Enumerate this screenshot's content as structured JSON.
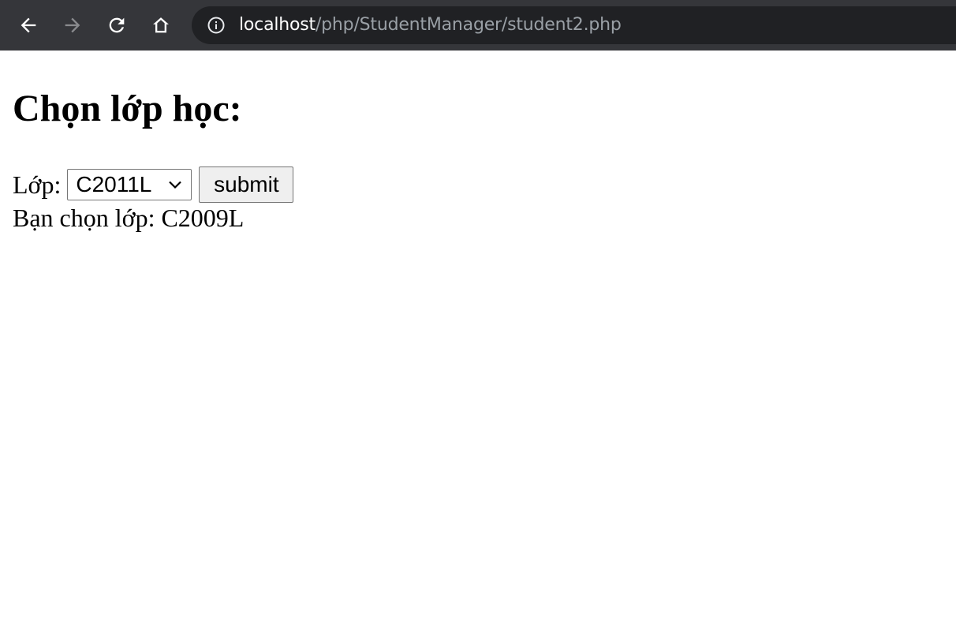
{
  "browser": {
    "url_host": "localhost",
    "url_path": "/php/StudentManager/student2.php"
  },
  "page": {
    "title": "Chọn lớp học:",
    "class_label": "Lớp:",
    "class_select": {
      "selected": "C2011L"
    },
    "submit_label": "submit",
    "result_prefix": "Bạn chọn lớp: ",
    "result_value": "C2009L"
  },
  "colors": {
    "toolbar_bg": "#35363a",
    "omnibox_bg": "#202124",
    "url_host": "#ffffff",
    "url_path": "#9aa0a6"
  },
  "icons": {
    "back": "back-arrow-icon",
    "forward": "forward-arrow-icon",
    "reload": "reload-icon",
    "home": "home-icon",
    "site_info": "info-icon",
    "select_arrow": "chevron-down-icon"
  }
}
